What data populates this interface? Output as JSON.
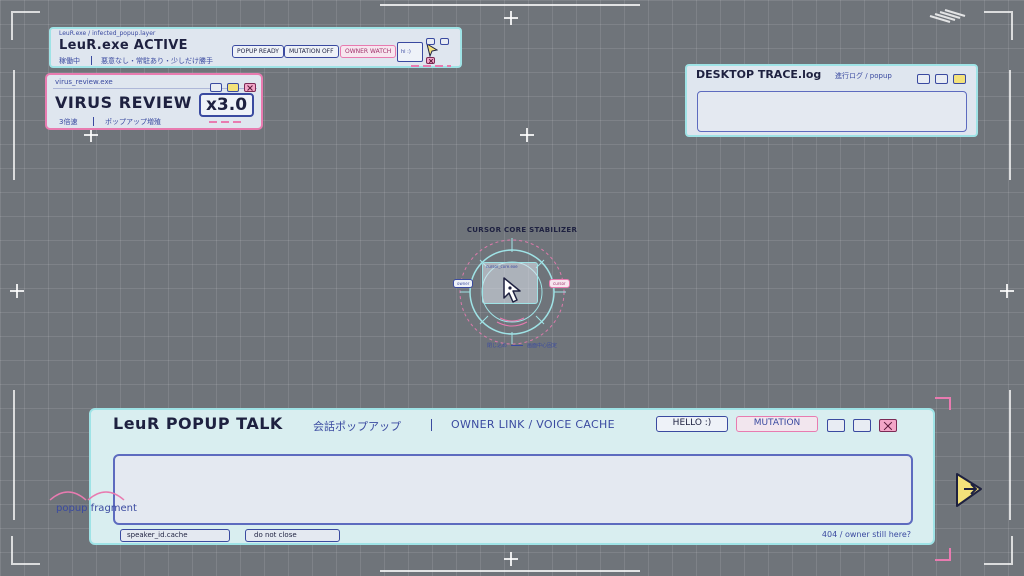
{
  "active_window": {
    "path": "LeuR.exe / infected_popup.layer",
    "title": "LeuR.exe ACTIVE",
    "status": "稼働中",
    "subtitle": "悪意なし・常駐あり・少しだけ勝手",
    "badges": [
      "POPUP READY",
      "MUTATION OFF",
      "OWNER WATCH"
    ],
    "mini_label": "hi :)"
  },
  "virus_window": {
    "path": "virus_review.exe",
    "title": "VIRUS REVIEW",
    "speed": "x3.0",
    "speed_label": "3倍速",
    "sub_label": "ポップアップ増殖"
  },
  "trace_window": {
    "title": "DESKTOP TRACE.log",
    "subtitle": "進行ログ / popup"
  },
  "cursor_core": {
    "title": "CURSOR CORE STABILIZER",
    "mini_title": "cursor_core.exe",
    "left_tag": "owner",
    "right_tag": "cursor",
    "left_caption": "閉じ込め",
    "right_caption": "画面中心固定"
  },
  "talk_window": {
    "title": "LeuR POPUP TALK",
    "subtitle": "会話ポップアップ",
    "link_text": "OWNER LINK / VOICE CACHE",
    "hello_button": "HELLO :)",
    "mutation_button": "MUTATION",
    "speaker_tag": "speaker_id.cache",
    "donot_tag": "do not close",
    "footer_text": "404 / owner still here?"
  },
  "fragment_label": "popup fragment",
  "colors": {
    "accent_blue": "#3a4aa0",
    "cyan": "#9fe3e6",
    "pink": "#e87bb0",
    "yellow": "#f4e27a",
    "panel": "#dfe6ef"
  }
}
